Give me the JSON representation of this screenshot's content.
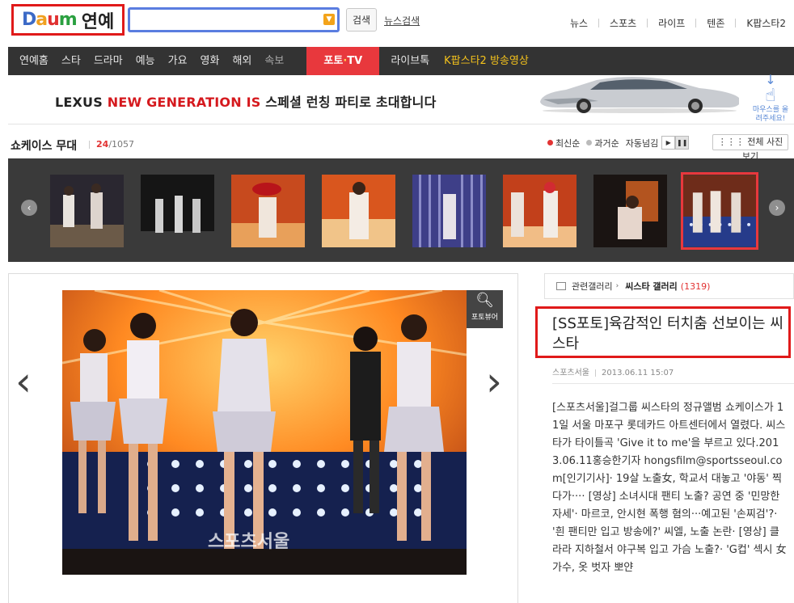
{
  "header": {
    "logo_text": "Daum",
    "logo_section": "연예",
    "search": {
      "value": "",
      "placeholder": ""
    },
    "search_button": "검색",
    "news_search": "뉴스검색",
    "top_links": [
      "뉴스",
      "스포츠",
      "라이프",
      "텐존",
      "K팝스타2"
    ]
  },
  "nav": {
    "items": [
      "연예홈",
      "스타",
      "드라마",
      "예능",
      "가요",
      "영화",
      "해외",
      "속보"
    ],
    "photo_tv": {
      "label": "포토",
      "dot": "·",
      "suffix": "TV"
    },
    "live": "라이브톡",
    "kpop": "K팝스타2 방송영상"
  },
  "banner": {
    "brand": "LEXUS",
    "highlight": "NEW GENERATION IS",
    "text": "스페셜 런칭 파티로 초대합니다",
    "mouse_hint": "마우스를 올려주세요!"
  },
  "showcase": {
    "title": "쇼케이스 무대",
    "current": "24",
    "total": "/1057",
    "sort_newest": "최신순",
    "sort_oldest": "과거순",
    "autoplay": "자동넘김",
    "all_photos": "전체 사진 보기"
  },
  "photo": {
    "zoom_label": "포토뷰어",
    "watermark": "스포츠서울"
  },
  "article": {
    "related_label": "관련갤러리",
    "gallery_name": "씨스타 갤러리",
    "gallery_count": "(1319)",
    "title": "[SS포토]육감적인 터치춤 선보이는 씨스타",
    "source": "스포츠서울",
    "date": "2013.06.11 15:07",
    "body": "[스포츠서울]걸그룹 씨스타의 정규앨범 쇼케이스가 11일 서울 마포구 롯데카드 아트센터에서 열렸다. 씨스타가 타이틀곡 'Give it to me'을 부르고 있다.2013.06.11홍승한기자 hongsfilm@sportsseoul.com[인기기사]· 19살 노출女, 학교서 대놓고 '야동' 찍다가···· [영상] 소녀시대 팬티 노출? 공연 중 '민망한 자세'· 마르코, 안시현 폭행 혐의···예고된 '손찌검'?· '흰 팬티만 입고 방송에?' 씨엘, 노출 논란· [영상] 클라라 지하철서 야구복 입고 가슴 노출?· 'G컵' 섹시 女가수, 옷 벗자 뽀얀"
  },
  "colors": {
    "highlight_red": "#e01a1a",
    "search_blue": "#5a7de0",
    "nav_bg": "#333333",
    "photo_tv_red": "#e8383d",
    "kpop_yellow": "#f4c21c",
    "strip_bg": "#3a3a3a"
  },
  "icons": {
    "search_dropdown": "chevron-down-icon",
    "strip_prev": "chevron-left-icon",
    "strip_next": "chevron-right-icon",
    "zoom": "magnifier-icon",
    "photo_prev": "large-chevron-left-icon",
    "photo_next": "large-chevron-right-icon",
    "mouse_hint": "pointing-hand-icon",
    "related": "gallery-icon"
  }
}
